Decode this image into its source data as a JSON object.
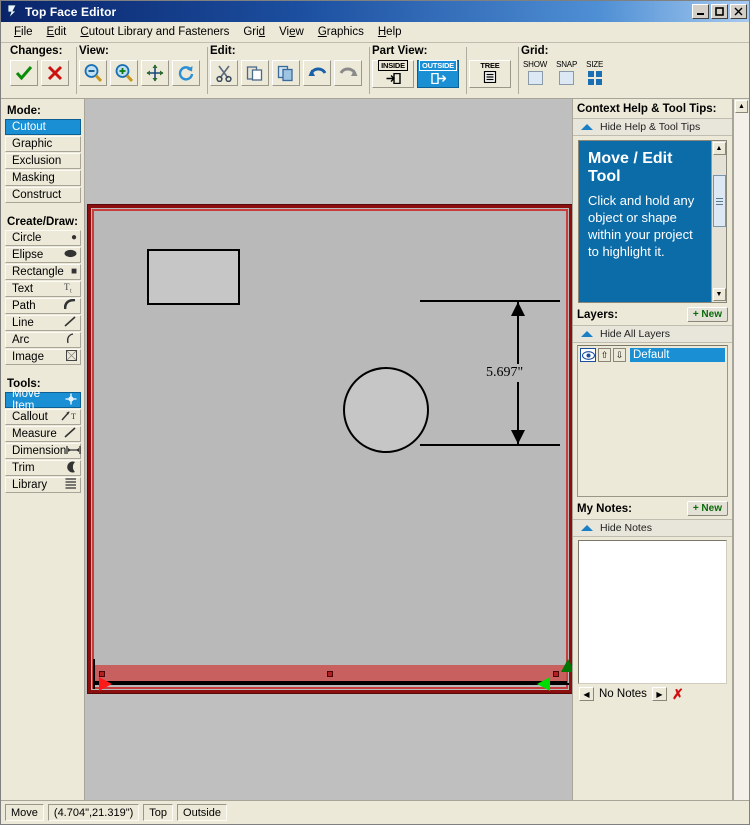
{
  "window": {
    "title": "Top Face Editor",
    "icon": "app-icon",
    "controls": {
      "minimize": "_",
      "maximize": "❐",
      "close": "✕"
    }
  },
  "menubar": {
    "items": [
      {
        "label": "File",
        "mnemonic": "F"
      },
      {
        "label": "Edit",
        "mnemonic": "E"
      },
      {
        "label": "Cutout Library and Fasteners",
        "mnemonic": "C"
      },
      {
        "label": "Grid",
        "mnemonic": "d"
      },
      {
        "label": "View",
        "mnemonic": "e"
      },
      {
        "label": "Graphics",
        "mnemonic": "G"
      },
      {
        "label": "Help",
        "mnemonic": "H"
      }
    ]
  },
  "toolbar": {
    "groups": [
      {
        "label": "Changes:",
        "buttons": [
          {
            "name": "accept-changes-button",
            "icon": "check-icon"
          },
          {
            "name": "reject-changes-button",
            "icon": "cross-icon"
          }
        ]
      },
      {
        "label": "View:",
        "buttons": [
          {
            "name": "zoom-out-button",
            "icon": "zoom-out-icon"
          },
          {
            "name": "zoom-in-button",
            "icon": "zoom-in-icon"
          },
          {
            "name": "pan-button",
            "icon": "move-arrows-icon"
          },
          {
            "name": "refresh-button",
            "icon": "refresh-icon"
          }
        ]
      },
      {
        "label": "Edit:",
        "buttons": [
          {
            "name": "cut-button",
            "icon": "scissors-icon"
          },
          {
            "name": "paste-button",
            "icon": "paste-icon"
          },
          {
            "name": "copy-button",
            "icon": "copy-icon"
          },
          {
            "name": "undo-button",
            "icon": "undo-arrow-icon"
          },
          {
            "name": "redo-button",
            "icon": "redo-arrow-icon"
          }
        ]
      },
      {
        "label": "Part View:",
        "buttons": [
          {
            "name": "inside-view-button",
            "label": "INSIDE",
            "icon": "arrow-into-box-icon",
            "selected": false
          },
          {
            "name": "outside-view-button",
            "label": "OUTSIDE",
            "icon": "arrow-out-of-box-icon",
            "selected": true
          },
          {
            "name": "tree-view-button",
            "label": "TREE",
            "icon": "list-icon",
            "selected": false
          }
        ]
      },
      {
        "label": "Grid:",
        "controls": [
          {
            "name": "grid-show-checkbox",
            "caption": "SHOW",
            "checked": false
          },
          {
            "name": "grid-snap-checkbox",
            "caption": "SNAP",
            "checked": false
          },
          {
            "name": "grid-size-button",
            "caption": "SIZE",
            "icon": "four-squares-icon"
          }
        ]
      }
    ]
  },
  "sidebar": {
    "mode": {
      "heading": "Mode:",
      "items": [
        {
          "label": "Cutout",
          "selected": true
        },
        {
          "label": "Graphic",
          "selected": false
        },
        {
          "label": "Exclusion",
          "selected": false
        },
        {
          "label": "Masking",
          "selected": false
        },
        {
          "label": "Construct",
          "selected": false
        }
      ]
    },
    "create_draw": {
      "heading": "Create/Draw:",
      "items": [
        {
          "label": "Circle",
          "icon": "circle-icon",
          "glyph": "●"
        },
        {
          "label": "Elipse",
          "icon": "ellipse-icon",
          "glyph": "⬬"
        },
        {
          "label": "Rectangle",
          "icon": "square-icon",
          "glyph": "■"
        },
        {
          "label": "Text",
          "icon": "text-icon",
          "glyph": "T"
        },
        {
          "label": "Path",
          "icon": "path-icon",
          "glyph": "◝"
        },
        {
          "label": "Line",
          "icon": "line-icon",
          "glyph": "╱"
        },
        {
          "label": "Arc",
          "icon": "arc-icon",
          "glyph": "◜"
        },
        {
          "label": "Image",
          "icon": "image-icon",
          "glyph": "▣"
        }
      ]
    },
    "tools": {
      "heading": "Tools:",
      "items": [
        {
          "label": "Move Item",
          "icon": "move-item-icon",
          "glyph": "✥",
          "selected": true
        },
        {
          "label": "Callout",
          "icon": "callout-icon",
          "glyph": "↗T",
          "selected": false
        },
        {
          "label": "Measure",
          "icon": "measure-icon",
          "glyph": "╱",
          "selected": false
        },
        {
          "label": "Dimension",
          "icon": "dimension-icon",
          "glyph": "↔",
          "selected": false
        },
        {
          "label": "Trim",
          "icon": "trim-icon",
          "glyph": "◗",
          "selected": false
        },
        {
          "label": "Library",
          "icon": "library-icon",
          "glyph": "☰",
          "selected": false
        }
      ]
    }
  },
  "canvas": {
    "part_name": "part-outline",
    "dimension_label": "5.697\"",
    "shapes": [
      {
        "name": "rectangle-cutout",
        "type": "rectangle"
      },
      {
        "name": "circle-cutout",
        "type": "circle"
      }
    ],
    "selection": {
      "name": "selected-edge",
      "color": "#cd4646"
    }
  },
  "help_panel": {
    "heading": "Context Help & Tool Tips:",
    "toggle_label": "Hide Help & Tool Tips",
    "tip_title": "Move / Edit Tool",
    "tip_body": "Click and hold any object or shape within your project to highlight it."
  },
  "layers_panel": {
    "heading": "Layers:",
    "new_button": "+ New",
    "toggle_label": "Hide All Layers",
    "items": [
      {
        "name": "Default",
        "visible": true,
        "selected": true
      }
    ]
  },
  "notes_panel": {
    "heading": "My Notes:",
    "new_button": "+ New",
    "toggle_label": "Hide Notes",
    "text": "",
    "status": "No Notes",
    "prev_label": "◀",
    "next_label": "▶",
    "delete_label": "✗"
  },
  "statusbar": {
    "fields": [
      {
        "name": "status-mode",
        "value": "Move"
      },
      {
        "name": "status-coordinates",
        "value": "(4.704\",21.319\")"
      },
      {
        "name": "status-face",
        "value": "Top"
      },
      {
        "name": "status-view",
        "value": "Outside"
      }
    ]
  },
  "colors": {
    "selection_red": "#cd4646",
    "border_red": "#8b0f0f",
    "accent_blue": "#1a8fd4",
    "help_blue": "#0b6ca8",
    "canvas_gray": "#bfbfbf",
    "part_gray": "#b9b9b9"
  }
}
